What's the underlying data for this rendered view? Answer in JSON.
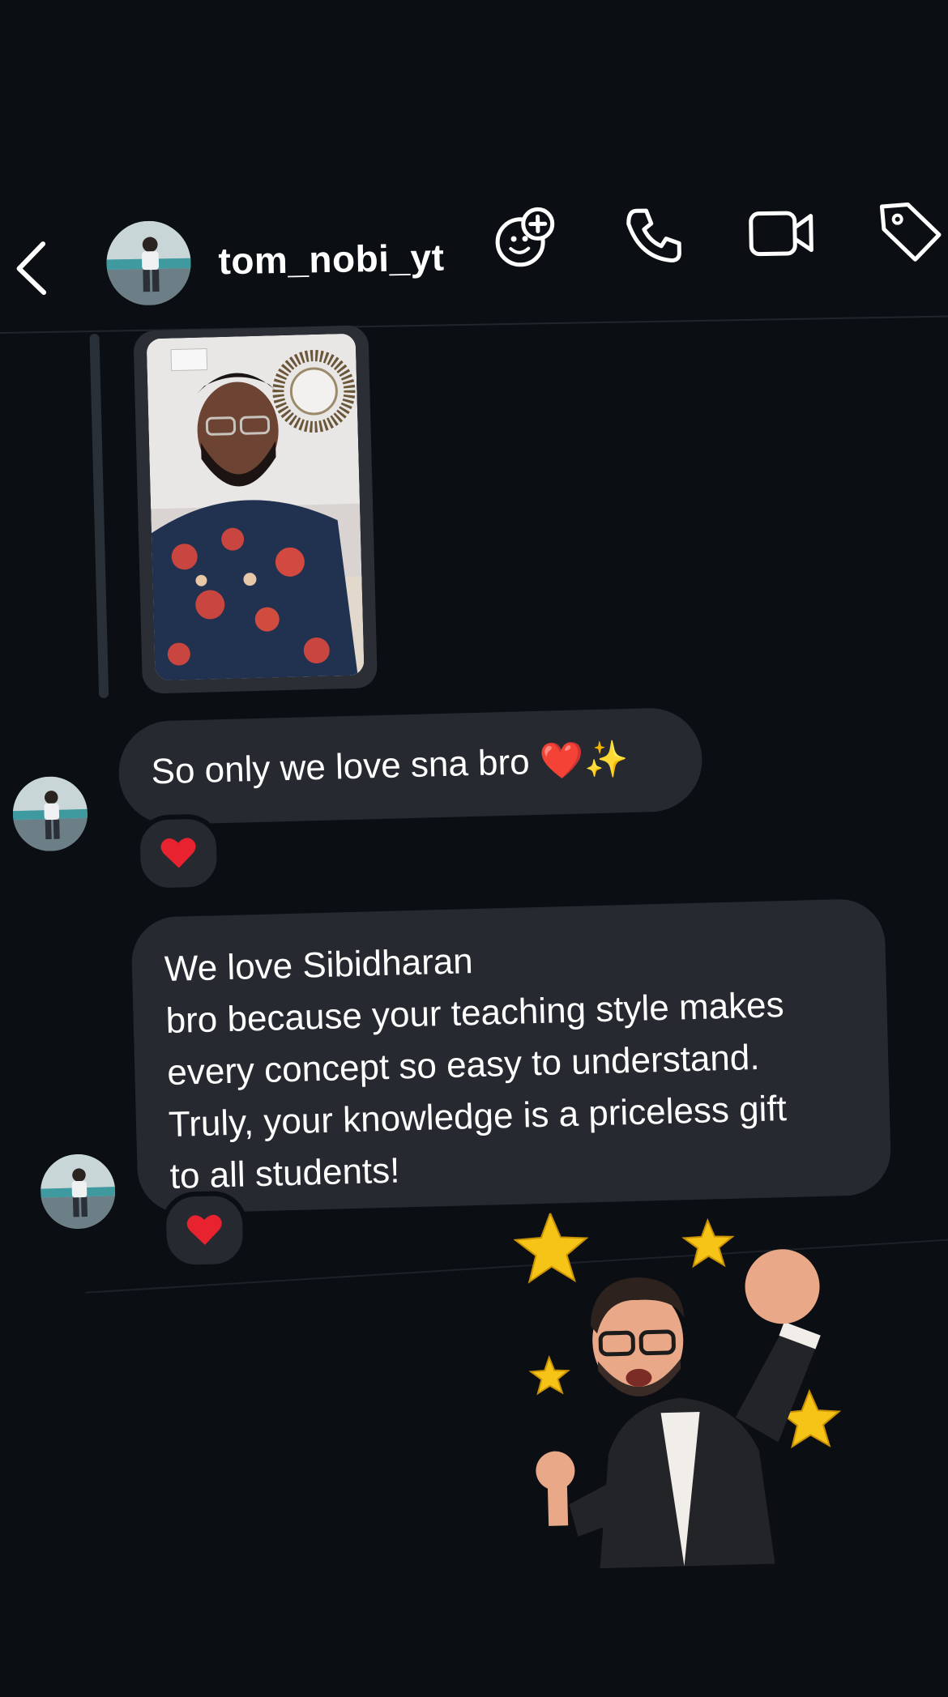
{
  "header": {
    "username": "tom_nobi_yt",
    "icons": {
      "back": "chevron-left-icon",
      "effects": "face-effects-plus-icon",
      "call": "phone-icon",
      "video": "video-camera-icon",
      "tag": "tag-icon"
    }
  },
  "messages": [
    {
      "type": "image",
      "icon": "photo-reply"
    },
    {
      "type": "text",
      "text": "So only we love sna bro ❤️✨",
      "reaction": "❤️"
    },
    {
      "type": "text",
      "lines": [
        "We love Sibidharan",
        "bro because your teaching style makes",
        "every concept so easy to understand.",
        "Truly, your knowledge is a priceless gift",
        "to all students!"
      ],
      "reaction": "❤️"
    },
    {
      "type": "sticker",
      "icon": "avatar-sticker-cheering"
    }
  ],
  "colors": {
    "background": "#0b0f13",
    "bubble": "#262a30",
    "heart": "#e8232f",
    "star": "#f6c417"
  }
}
